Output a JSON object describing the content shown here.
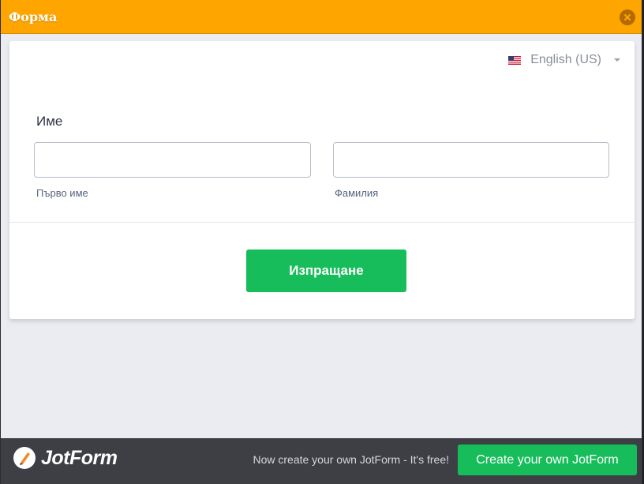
{
  "window": {
    "title": "Форма",
    "close_icon": "close-icon"
  },
  "language": {
    "flag_icon": "us-flag-icon",
    "selected": "English (US)",
    "caret_icon": "caret-down-icon"
  },
  "form": {
    "name_label": "Име",
    "first_name": {
      "value": "",
      "sublabel": "Първо име"
    },
    "last_name": {
      "value": "",
      "sublabel": "Фамилия"
    },
    "submit_label": "Изпращане"
  },
  "footer": {
    "logo_icon": "jotform-logo-icon",
    "logo_text": "JotForm",
    "promo_text": "Now create your own JotForm - It's free!",
    "cta_label": "Create your own JotForm"
  },
  "colors": {
    "titlebar": "#ffa500",
    "accent_green": "#18bd5b",
    "footer_bg": "#3d3f45",
    "page_bg": "#ebecf2"
  }
}
